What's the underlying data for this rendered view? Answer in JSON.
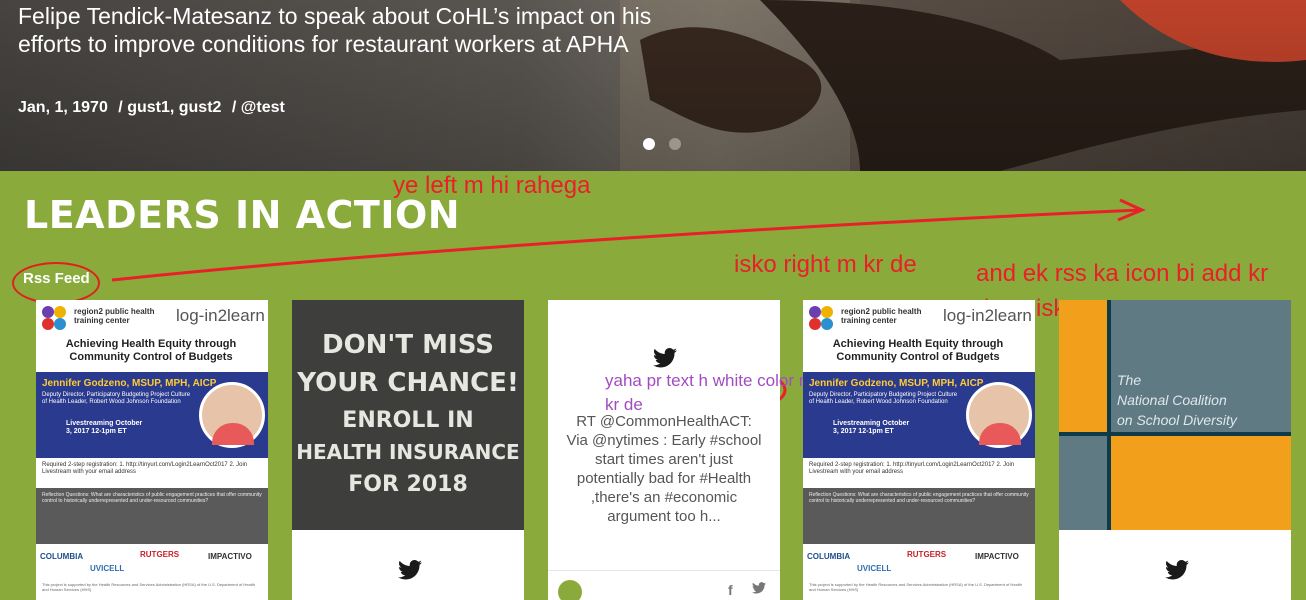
{
  "hero": {
    "title": "Felipe Tendick-Matesanz to speak about CoHL’s impact on his efforts to improve conditions for restaurant workers at APHA",
    "date": "Jan, 1, 1970",
    "authors": "/ gust1, gust2",
    "handle": "/ @test",
    "slides": 2,
    "active_slide": 1
  },
  "section": {
    "title": "LEADERS IN ACTION",
    "rss_label": "Rss Feed"
  },
  "annotations": {
    "left_note": "ye left m hi rahega",
    "right_note": "isko right m kr de",
    "rss_icon_note": "and ek rss ka icon bi add kr dena iske sat",
    "color_note": "yaha pr text h white color m uska color green kr de"
  },
  "cards": {
    "flyer": {
      "region": "region2 public health training center",
      "brand": "log-in2learn",
      "title": "Achieving Health Equity through Community Control of Budgets",
      "name": "Jennifer Godzeno, MSUP, MPH, AICP",
      "role": "Deputy Director, Participatory Budgeting Project Culture of Health Leader, Robert Wood Johnson Foundation",
      "date": "Livestreaming October 3, 2017 12-1pm ET",
      "mid": "Required 2-step registration: 1. http://tinyurl.com/Login2LearnOct2017 2. Join Livestream with your email address",
      "grey": "Reflection Questions: What are characteristics of public engagement practices that offer community control to historically underrepresented and under-resourced communities?",
      "sponsor_1": "COLUMBIA",
      "sponsor_2": "RUTGERS",
      "sponsor_3": "IMPACTIVO",
      "sponsor_4": "UVICELL",
      "foot": "This project is supported by the Health Resources and Services Administration (HRSA) of the U.S. Department of Health and Human Services (HHS)"
    },
    "chalk": {
      "line1": "DON'T MISS",
      "line2": "YOUR CHANCE!",
      "line3": "ENROLL IN",
      "line4": "HEALTH INSURANCE",
      "line5": "FOR 2018"
    },
    "tweet": {
      "prefix": "RT @CommonHealthACT:",
      "text": "Via @nytimes : Early #school start times aren't just potentially bad for #Health ,there's an #economic argument too h..."
    },
    "coalition": {
      "line1": "The",
      "line2": "National Coalition",
      "line3": "on School Diversity"
    }
  },
  "icons": [
    "twitter-icon",
    "facebook-icon"
  ],
  "colors": {
    "green": "#8aab3c",
    "annotation_red": "#e8202a",
    "annotation_purple": "#a14cc0"
  }
}
